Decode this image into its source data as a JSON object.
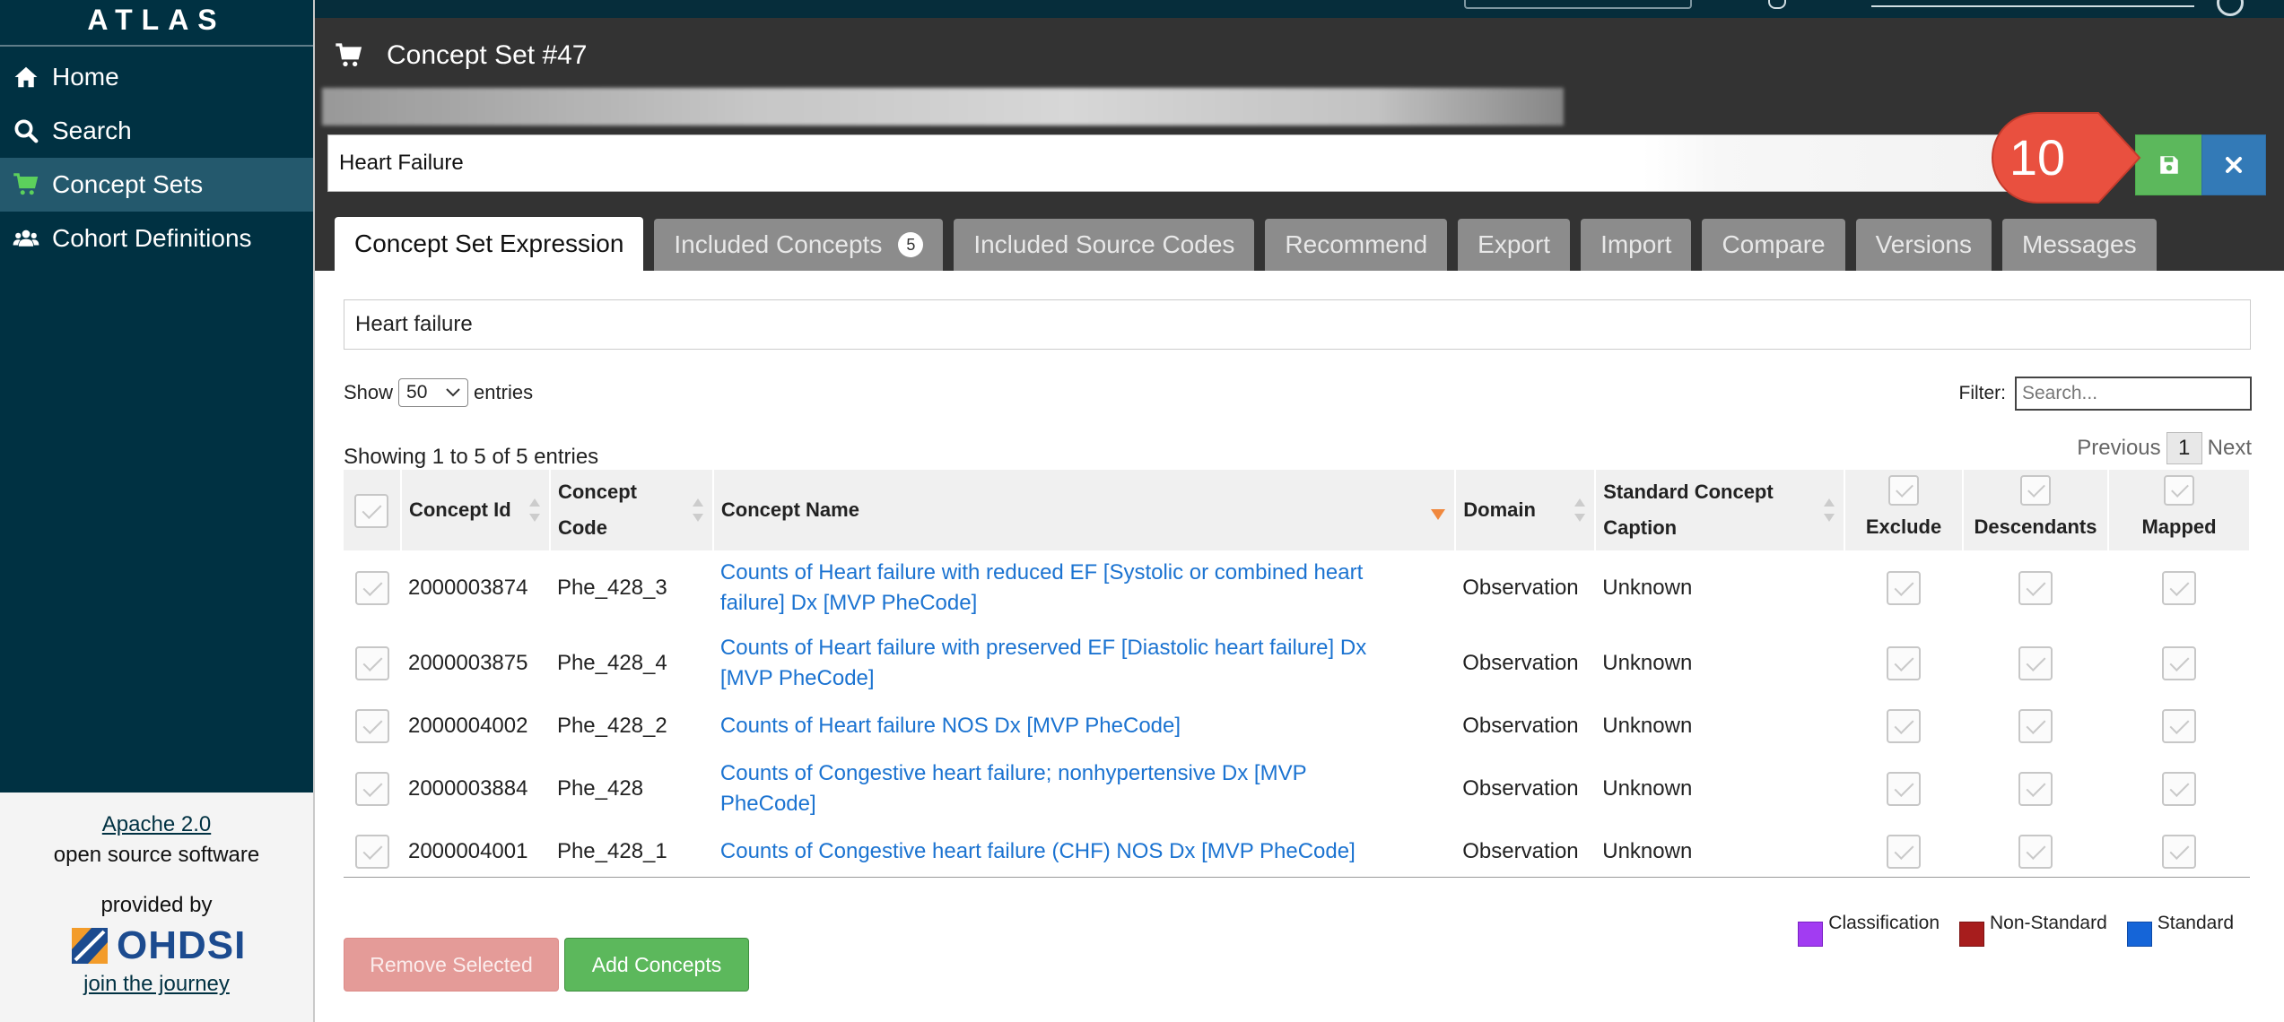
{
  "sidebar": {
    "brand": "ATLAS",
    "items": [
      {
        "label": "Home",
        "icon": "home-icon"
      },
      {
        "label": "Search",
        "icon": "search-icon"
      },
      {
        "label": "Concept Sets",
        "icon": "cart-icon",
        "active": true
      },
      {
        "label": "Cohort Definitions",
        "icon": "users-icon"
      }
    ],
    "footer": {
      "license_link": "Apache 2.0",
      "license_text": "open source software",
      "provided_by": "provided by",
      "org": "OHDSI",
      "join_link": "join the journey"
    }
  },
  "colors": {
    "sidebar_bg": "#003142",
    "sidebar_active": "#24596d",
    "header_bg": "#333333",
    "save_green": "#5cb85c",
    "close_blue": "#337ab7",
    "link_blue": "#1b73d1",
    "callout_red": "#ea4f3f",
    "classification": "#a23cf2",
    "non_standard": "#a71d1d",
    "standard": "#1565d8"
  },
  "header": {
    "title": "Concept Set #47",
    "name_value": "Heart Failure",
    "callout": "10",
    "save_icon": "floppy-disk-icon",
    "close_icon": "close-icon"
  },
  "tabs": [
    {
      "label": "Concept Set Expression",
      "active": true
    },
    {
      "label": "Included Concepts",
      "badge": "5"
    },
    {
      "label": "Included Source Codes"
    },
    {
      "label": "Recommend"
    },
    {
      "label": "Export"
    },
    {
      "label": "Import"
    },
    {
      "label": "Compare"
    },
    {
      "label": "Versions"
    },
    {
      "label": "Messages"
    }
  ],
  "content": {
    "expression_text": "Heart failure",
    "show_label": "Show",
    "show_value": "50",
    "entries_label": "entries",
    "filter_label": "Filter:",
    "filter_placeholder": "Search...",
    "showing_info": "Showing 1 to 5 of 5 entries",
    "pagination": {
      "previous": "Previous",
      "page": "1",
      "next": "Next"
    }
  },
  "table": {
    "headers": {
      "concept_id": "Concept Id",
      "concept_code_1": "Concept",
      "concept_code_2": "Code",
      "concept_name": "Concept Name",
      "domain": "Domain",
      "caption_1": "Standard Concept",
      "caption_2": "Caption",
      "exclude": "Exclude",
      "descendants": "Descendants",
      "mapped": "Mapped"
    },
    "rows": [
      {
        "id": "2000003874",
        "code": "Phe_428_3",
        "name_1": "Counts of Heart failure with reduced EF [Systolic or combined heart",
        "name_2": "failure] Dx [MVP PheCode]",
        "domain": "Observation",
        "caption": "Unknown"
      },
      {
        "id": "2000003875",
        "code": "Phe_428_4",
        "name_1": "Counts of Heart failure with preserved EF [Diastolic heart failure] Dx",
        "name_2": "[MVP PheCode]",
        "domain": "Observation",
        "caption": "Unknown"
      },
      {
        "id": "2000004002",
        "code": "Phe_428_2",
        "name_1": "Counts of Heart failure NOS Dx [MVP PheCode]",
        "name_2": "",
        "domain": "Observation",
        "caption": "Unknown"
      },
      {
        "id": "2000003884",
        "code": "Phe_428",
        "name_1": "Counts of Congestive heart failure; nonhypertensive Dx [MVP",
        "name_2": "PheCode]",
        "domain": "Observation",
        "caption": "Unknown"
      },
      {
        "id": "2000004001",
        "code": "Phe_428_1",
        "name_1": "Counts of Congestive heart failure (CHF) NOS Dx [MVP PheCode]",
        "name_2": "",
        "domain": "Observation",
        "caption": "Unknown"
      }
    ]
  },
  "footer": {
    "remove_label": "Remove Selected",
    "add_label": "Add Concepts",
    "legend": [
      {
        "label": "Classification"
      },
      {
        "label": "Non-Standard"
      },
      {
        "label": "Standard"
      }
    ]
  }
}
